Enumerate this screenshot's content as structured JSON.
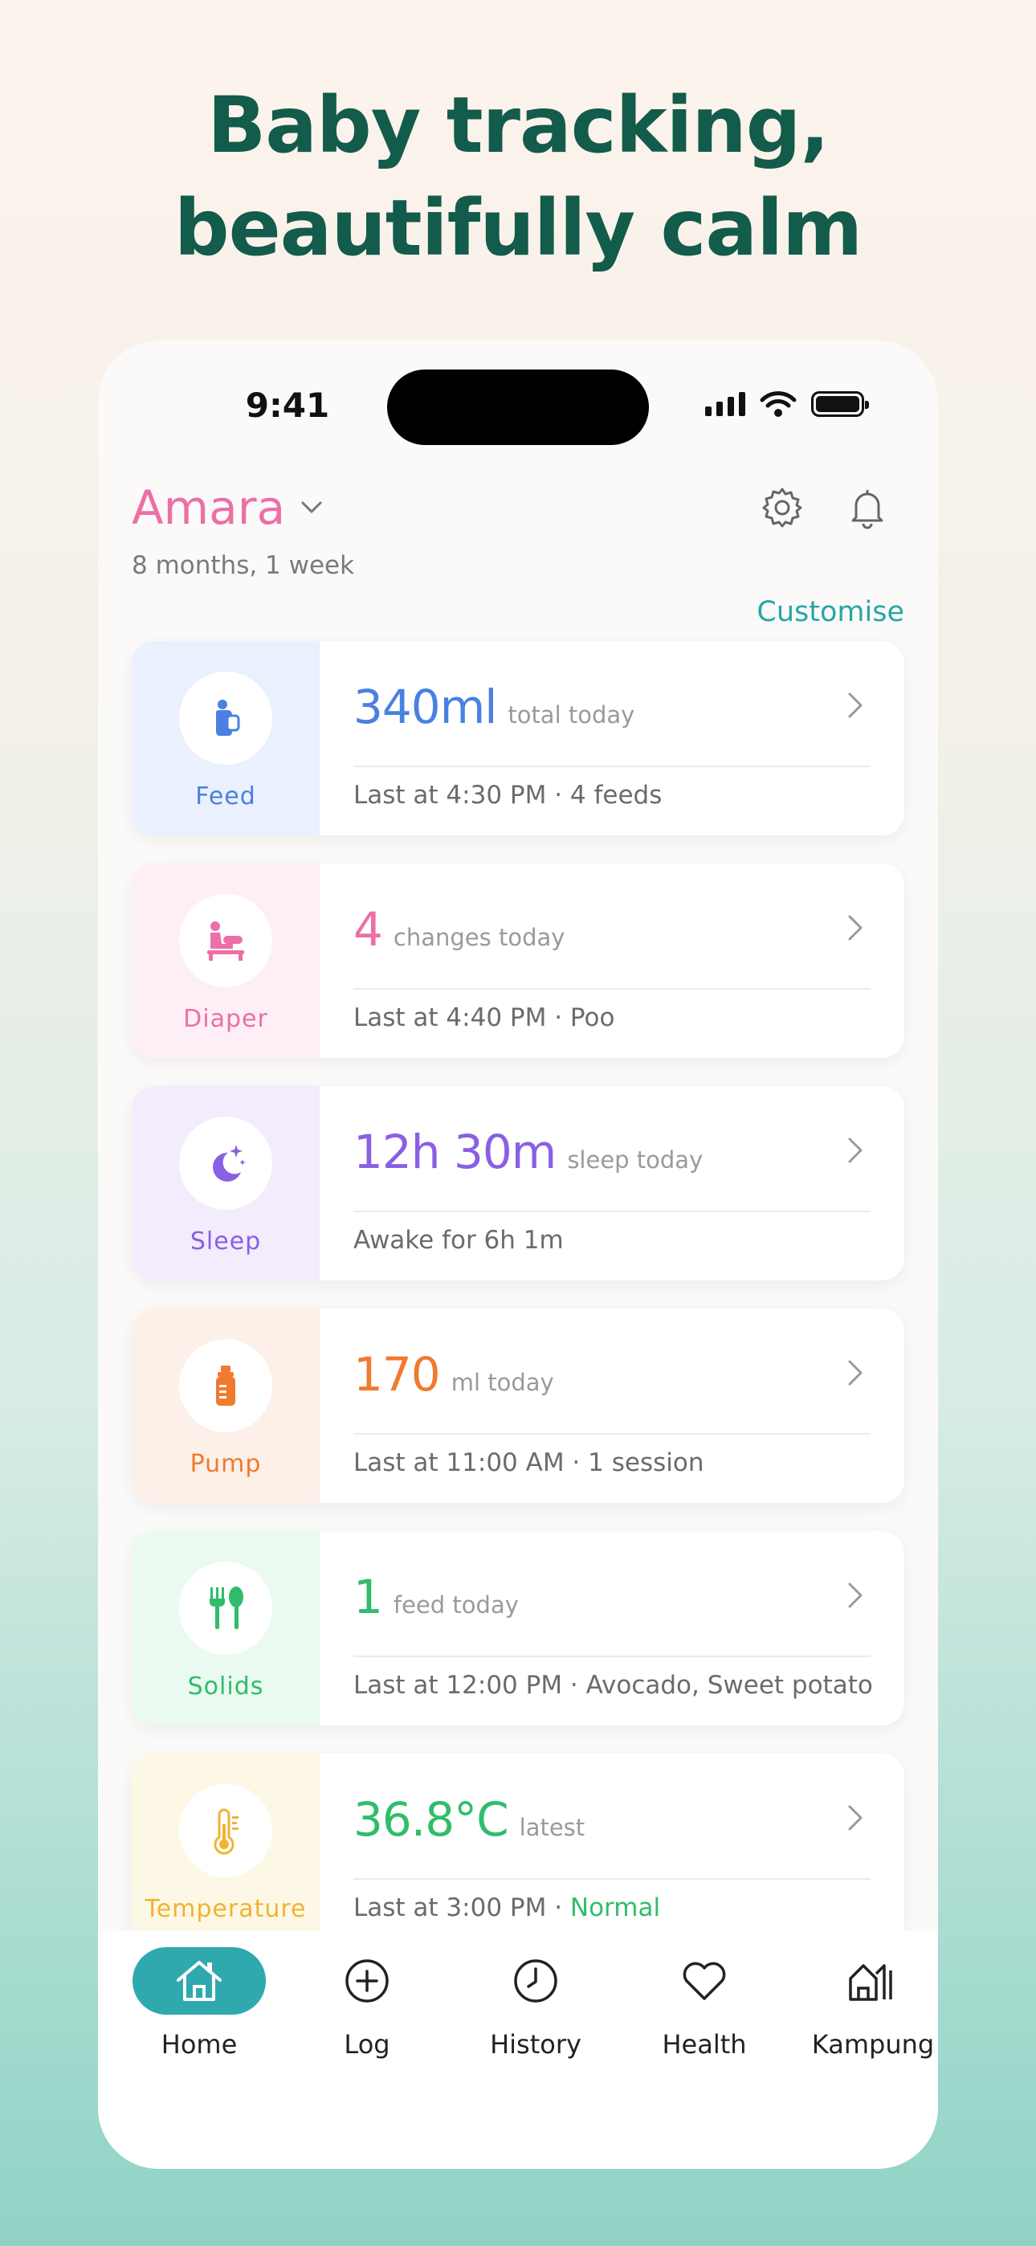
{
  "headline": {
    "line1": "Baby tracking,",
    "line2": "beautifully calm"
  },
  "status_bar": {
    "time": "9:41"
  },
  "header": {
    "baby_name": "Amara",
    "baby_age": "8 months, 1 week",
    "customise_label": "Customise"
  },
  "cards": [
    {
      "label": "Feed",
      "value": "340ml",
      "unit": "total today",
      "detail": "Last at 4:30 PM · 4 feeds",
      "color": "#4a80e0",
      "bg": "#eaf0fd",
      "icon": "baby-bottle-icon"
    },
    {
      "label": "Diaper",
      "value": "4",
      "unit": "changes today",
      "detail": "Last at 4:40 PM · Poo",
      "color": "#ec6fa7",
      "bg": "#fdeff5",
      "icon": "changing-table-icon"
    },
    {
      "label": "Sleep",
      "value": "12h 30m",
      "unit": "sleep today",
      "detail": "Awake for 6h 1m",
      "color": "#8a5fe3",
      "bg": "#f2ecfd",
      "icon": "moon-stars-icon"
    },
    {
      "label": "Pump",
      "value": "170",
      "unit": "ml today",
      "detail": "Last at 11:00 AM · 1 session",
      "color": "#f07a2e",
      "bg": "#fdf0e8",
      "icon": "pump-bottle-icon"
    },
    {
      "label": "Solids",
      "value": "1",
      "unit": "feed today",
      "detail": "Last at 12:00 PM · Avocado, Sweet potato",
      "color": "#2fbd6a",
      "bg": "#eafaf0",
      "icon": "fork-spoon-icon"
    },
    {
      "label": "Temperature",
      "value": "36.8°C",
      "unit": "latest",
      "detail_prefix": "Last at 3:00 PM · ",
      "detail_status": "Normal",
      "color": "#2fbd6a",
      "label_color": "#f0b330",
      "bg": "#fdf8e6",
      "icon": "thermometer-icon"
    }
  ],
  "nav": [
    {
      "label": "Home",
      "icon": "home-icon",
      "active": true
    },
    {
      "label": "Log",
      "icon": "plus-circle-icon",
      "active": false
    },
    {
      "label": "History",
      "icon": "clock-icon",
      "active": false
    },
    {
      "label": "Health",
      "icon": "heart-icon",
      "active": false
    },
    {
      "label": "Kampung",
      "icon": "houses-icon",
      "active": false
    }
  ],
  "colors": {
    "accent": "#2fa9ae",
    "headline": "#135b4a",
    "name": "#ec6fa7"
  }
}
